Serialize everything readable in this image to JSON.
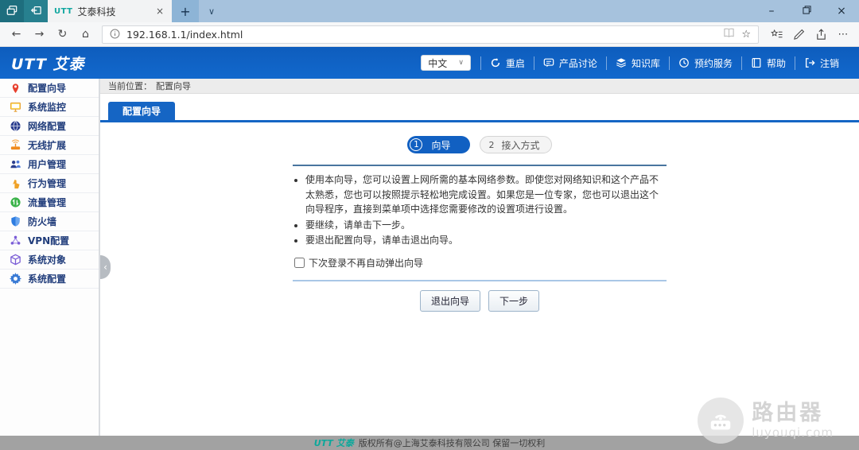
{
  "glyphs": {
    "back": "←",
    "forward": "→",
    "refresh": "↻",
    "home": "⌂",
    "star": "☆",
    "more": "⋯",
    "minimize": "–",
    "close": "×",
    "plus": "+",
    "chevron_down": "∨",
    "collapse": "‹"
  },
  "browser": {
    "tab": {
      "favicon": "UTT",
      "title": "艾泰科技"
    },
    "url": "192.168.1.1/index.html"
  },
  "header": {
    "logo": "UTT 艾泰",
    "language": "中文",
    "menu": [
      {
        "label": "重启"
      },
      {
        "label": "产品讨论"
      },
      {
        "label": "知识库"
      },
      {
        "label": "预约服务"
      },
      {
        "label": "帮助"
      },
      {
        "label": "注销"
      }
    ]
  },
  "sidebar": {
    "items": [
      {
        "label": "配置向导"
      },
      {
        "label": "系统监控"
      },
      {
        "label": "网络配置"
      },
      {
        "label": "无线扩展"
      },
      {
        "label": "用户管理"
      },
      {
        "label": "行为管理"
      },
      {
        "label": "流量管理"
      },
      {
        "label": "防火墙"
      },
      {
        "label": "VPN配置"
      },
      {
        "label": "系统对象"
      },
      {
        "label": "系统配置"
      }
    ]
  },
  "breadcrumb": {
    "label": "当前位置：",
    "value": "配置向导"
  },
  "content_tab": "配置向导",
  "wizard": {
    "steps": [
      {
        "num": "1",
        "label": "向导"
      },
      {
        "num": "2",
        "label": "接入方式"
      }
    ],
    "bullets": [
      "使用本向导，您可以设置上网所需的基本网络参数。即使您对网络知识和这个产品不太熟悉，您也可以按照提示轻松地完成设置。如果您是一位专家，您也可以退出这个向导程序，直接到菜单项中选择您需要修改的设置项进行设置。",
      "要继续，请单击下一步。",
      "要退出配置向导，请单击退出向导。"
    ],
    "checkbox_label": "下次登录不再自动弹出向导",
    "buttons": [
      {
        "label": "退出向导"
      },
      {
        "label": "下一步"
      }
    ]
  },
  "footer": {
    "logo": "UTT 艾泰",
    "text": "版权所有@上海艾泰科技有限公司 保留一切权利"
  },
  "watermark": {
    "title": "路由器",
    "subtitle": "luyouqi.com"
  },
  "colors": {
    "accent_blue": "#1565c4",
    "header_blue": "#0f62c3",
    "teal_logo": "#0ca89b"
  }
}
